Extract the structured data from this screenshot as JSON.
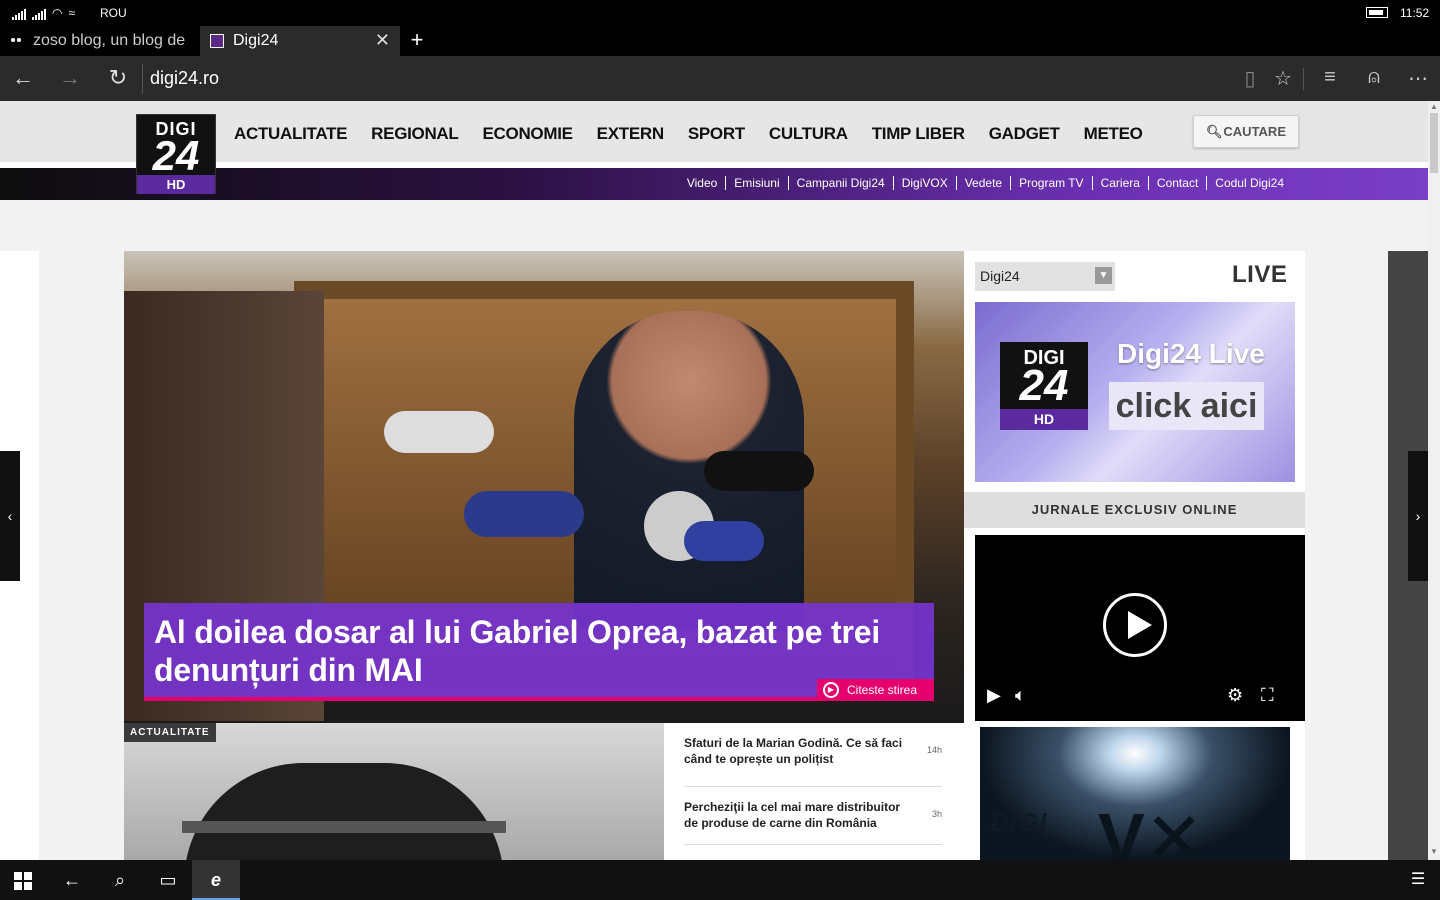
{
  "status": {
    "carrier": "ROU",
    "time": "11:52"
  },
  "tabs": [
    {
      "title": "zoso blog, un blog de"
    },
    {
      "title": "Digi24"
    }
  ],
  "address": {
    "url": "digi24.ro"
  },
  "site": {
    "logo": {
      "top": "DIGI",
      "mid": "24",
      "badge": "HD"
    },
    "main_nav": [
      "ACTUALITATE",
      "REGIONAL",
      "ECONOMIE",
      "EXTERN",
      "SPORT",
      "CULTURA",
      "TIMP LIBER",
      "GADGET",
      "METEO"
    ],
    "search_label": "CAUTARE",
    "sub_nav": [
      "Video",
      "Emisiuni",
      "Campanii Digi24",
      "DigiVOX",
      "Vedete",
      "Program TV",
      "Cariera",
      "Contact",
      "Codul Digi24"
    ]
  },
  "hero": {
    "headline": "Al doilea dosar al lui Gabriel Oprea, bazat pe trei denunțuri din MAI",
    "read_more": "Citeste stirea"
  },
  "story2": {
    "tag": "ACTUALITATE"
  },
  "news_list": [
    {
      "title": "Sfaturi de la Marian Godină. Ce să faci când te oprește un polițist",
      "age": "14h"
    },
    {
      "title": "Percheziţii la cel mai mare distribuitor de produse de carne din România",
      "age": "3h"
    }
  ],
  "sidebar": {
    "channel_select": "Digi24",
    "live_label": "LIVE",
    "live_banner_title": "Digi24 Live",
    "live_banner_cta": "click aici",
    "journal_heading": "JURNALE EXCLUSIV ONLINE",
    "vox_text": "DIGI"
  }
}
